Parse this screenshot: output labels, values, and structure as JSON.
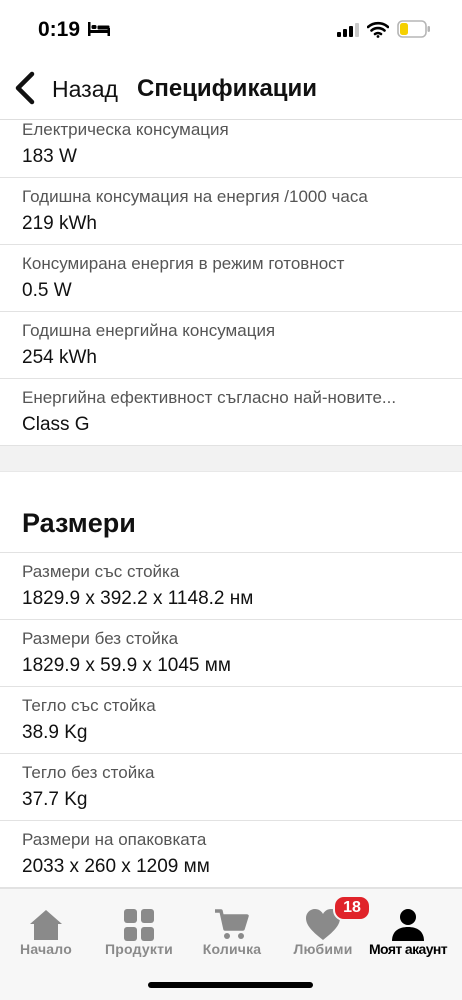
{
  "status_bar": {
    "time": "0:19",
    "icons": [
      "bed-icon",
      "signal-icon",
      "wifi-icon",
      "battery-icon"
    ],
    "battery_color": "#f5d000"
  },
  "header": {
    "back_label": "Назад",
    "title": "Спецификации"
  },
  "energy_specs": [
    {
      "label": "Електрическа консумация",
      "value": "183 W"
    },
    {
      "label": "Годишна консумация на енергия /1000 часа",
      "value": "219 kWh"
    },
    {
      "label": "Консумирана енергия в режим готовност",
      "value": "0.5 W"
    },
    {
      "label": "Годишна енергийна консумация",
      "value": "254 kWh"
    },
    {
      "label": "Енергийна ефективност съгласно най-новите...",
      "value": "Class G"
    }
  ],
  "dimensions_section": {
    "title": "Размери",
    "items": [
      {
        "label": "Размери със стойка",
        "value": "1829.9 x 392.2 x 1148.2 нм"
      },
      {
        "label": "Размери без стойка",
        "value": "1829.9 x 59.9 x 1045 мм"
      },
      {
        "label": "Тегло със стойка",
        "value": "38.9 Kg"
      },
      {
        "label": "Тегло без стойка",
        "value": "37.7 Kg"
      },
      {
        "label": "Размери на опаковката",
        "value": "2033 x 260 x 1209 мм"
      }
    ]
  },
  "bottom_nav": {
    "items": [
      {
        "label": "Начало",
        "icon": "home-icon"
      },
      {
        "label": "Продукти",
        "icon": "grid-icon"
      },
      {
        "label": "Количка",
        "icon": "cart-icon"
      },
      {
        "label": "Любими",
        "icon": "heart-icon"
      },
      {
        "label": "Моят акаунт",
        "icon": "user-icon"
      }
    ],
    "favorites_badge": "18",
    "active_item": "Моят акаунт",
    "badge_color": "#e0232a"
  }
}
